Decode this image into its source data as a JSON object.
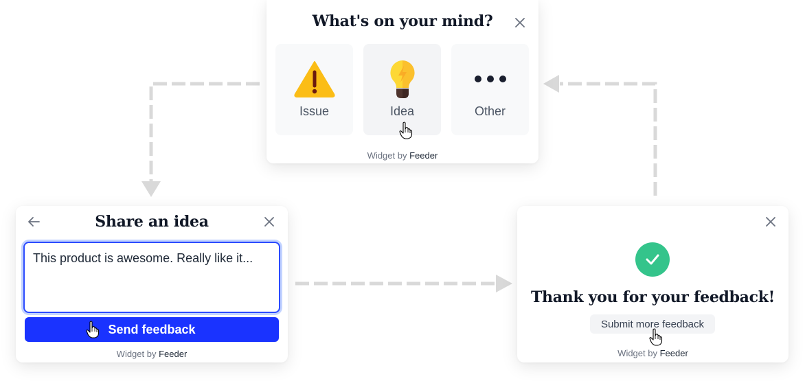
{
  "choose_widget": {
    "title": "What's on your mind?",
    "options": [
      {
        "label": "Issue",
        "icon": "warning-icon"
      },
      {
        "label": "Idea",
        "icon": "lightbulb-icon"
      },
      {
        "label": "Other",
        "icon": "more-dots-icon"
      }
    ],
    "footer_prefix": "Widget by",
    "footer_brand": "Feeder"
  },
  "idea_widget": {
    "title": "Share an idea",
    "textarea_value": "This product is awesome. Really like it...",
    "send_label": "Send feedback",
    "footer_prefix": "Widget by",
    "footer_brand": "Feeder"
  },
  "thanks_widget": {
    "title": "Thank you for your feedback!",
    "more_label": "Submit more feedback",
    "footer_prefix": "Widget by",
    "footer_brand": "Feeder"
  },
  "colors": {
    "primary": "#1a33ff",
    "success": "#34c48b",
    "arrow": "#d9d9d9"
  }
}
